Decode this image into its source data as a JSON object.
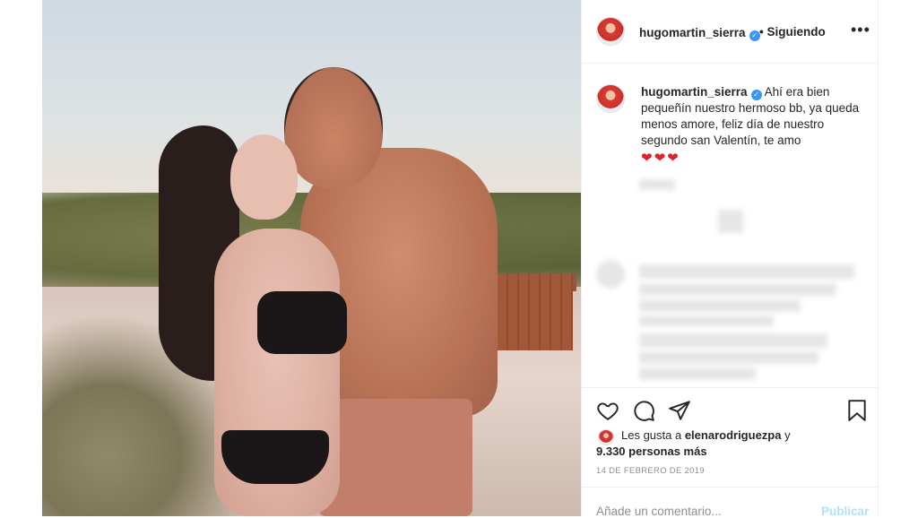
{
  "post": {
    "photo_alt": "Couple on beach",
    "header": {
      "username": "hugomartin_sierra",
      "separator": "•",
      "follow_status": "Siguiendo",
      "more_icon": "ellipsis-icon"
    },
    "caption": {
      "username": "hugomartin_sierra",
      "text": "Ahí era bien pequeñín nuestro hermoso bb, ya queda menos amore, feliz día de nuestro segundo san Valentín, te amo",
      "hearts": "❤❤❤"
    },
    "actions": {
      "like_icon": "heart-outline-icon",
      "comment_icon": "comment-icon",
      "share_icon": "paper-plane-icon",
      "save_icon": "bookmark-icon"
    },
    "likes": {
      "prefix": "Les gusta a ",
      "liker": "elenarodriguezpa",
      "conjunction": " y",
      "others": "9.330 personas más"
    },
    "date": "14 DE FEBRERO DE 2019",
    "comment": {
      "placeholder": "Añade un comentario...",
      "publish_label": "Publicar"
    }
  },
  "colors": {
    "accent": "#3897f0",
    "publish_disabled": "#b2dffc",
    "heart": "#e0202b",
    "border": "#efefef"
  }
}
